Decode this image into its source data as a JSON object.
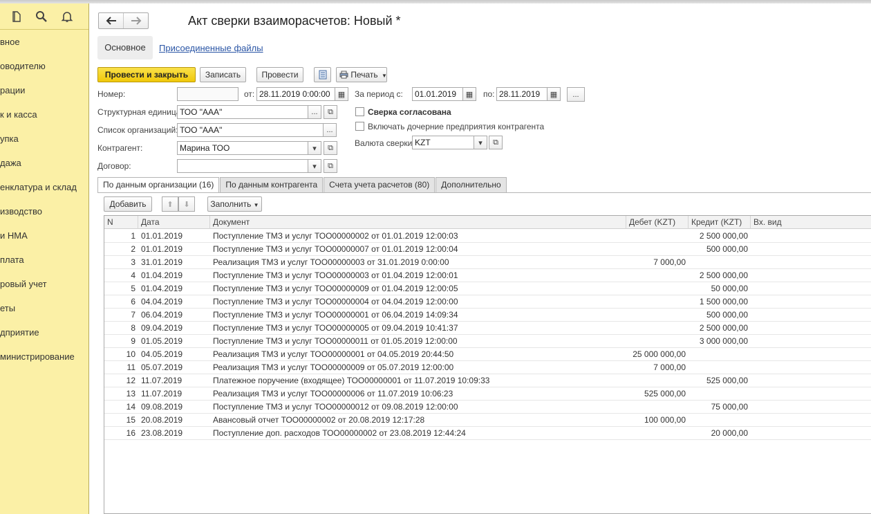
{
  "sidebar": {
    "items": [
      "вное",
      "оводителю",
      "рации",
      "к и касса",
      "упка",
      "дажа",
      "енклатура и склад",
      "изводство",
      "и НМА",
      "плата",
      "ровый учет",
      "еты",
      "дприятие",
      "министрирование"
    ]
  },
  "header": {
    "title": "Акт сверки взаиморасчетов: Новый *",
    "tab_main": "Основное",
    "tab_files": "Присоединенные файлы"
  },
  "toolbar": {
    "post_close": "Провести и закрыть",
    "save": "Записать",
    "post": "Провести",
    "print": "Печать"
  },
  "form": {
    "number_label": "Номер:",
    "number_value": "",
    "from_label": "от:",
    "date_value": "28.11.2019  0:00:00",
    "period_label": "За период с:",
    "period_from": "01.01.2019",
    "period_to_label": "по:",
    "period_to": "28.11.2019",
    "struct_label": "Структурная единица:",
    "struct_value": "ТОО \"ААА\"",
    "orgs_label": "Список организаций:",
    "orgs_value": "ТОО \"ААА\"",
    "contractor_label": "Контрагент:",
    "contractor_value": "Марина ТОО",
    "contract_label": "Договор:",
    "contract_value": "",
    "agreed_label": "Сверка согласована",
    "include_label": "Включать дочерние предприятия контрагента",
    "currency_label": "Валюта сверки:",
    "currency_value": "KZT"
  },
  "tabs": [
    "По данным организации (16)",
    "По данным контрагента",
    "Счета учета расчетов (80)",
    "Дополнительно"
  ],
  "table_toolbar": {
    "add": "Добавить",
    "fill": "Заполнить"
  },
  "table": {
    "headers": [
      "N",
      "Дата",
      "Документ",
      "Дебет (KZT)",
      "Кредит (KZT)",
      "Вх. вид"
    ],
    "rows": [
      [
        "1",
        "01.01.2019",
        "Поступление ТМЗ и услуг ТОО00000002 от 01.01.2019 12:00:03",
        "",
        "2 500 000,00"
      ],
      [
        "2",
        "01.01.2019",
        "Поступление ТМЗ и услуг ТОО00000007 от 01.01.2019 12:00:04",
        "",
        "500 000,00"
      ],
      [
        "3",
        "31.01.2019",
        "Реализация ТМЗ и услуг ТОО00000003 от 31.01.2019 0:00:00",
        "7 000,00",
        ""
      ],
      [
        "4",
        "01.04.2019",
        "Поступление ТМЗ и услуг ТОО00000003 от 01.04.2019 12:00:01",
        "",
        "2 500 000,00"
      ],
      [
        "5",
        "01.04.2019",
        "Поступление ТМЗ и услуг ТОО00000009 от 01.04.2019 12:00:05",
        "",
        "50 000,00"
      ],
      [
        "6",
        "04.04.2019",
        "Поступление ТМЗ и услуг ТОО00000004 от 04.04.2019 12:00:00",
        "",
        "1 500 000,00"
      ],
      [
        "7",
        "06.04.2019",
        "Поступление ТМЗ и услуг ТОО00000001 от 06.04.2019 14:09:34",
        "",
        "500 000,00"
      ],
      [
        "8",
        "09.04.2019",
        "Поступление ТМЗ и услуг ТОО00000005 от 09.04.2019 10:41:37",
        "",
        "2 500 000,00"
      ],
      [
        "9",
        "01.05.2019",
        "Поступление ТМЗ и услуг ТОО00000011 от 01.05.2019 12:00:00",
        "",
        "3 000 000,00"
      ],
      [
        "10",
        "04.05.2019",
        "Реализация ТМЗ и услуг ТОО00000001 от 04.05.2019 20:44:50",
        "25 000 000,00",
        ""
      ],
      [
        "11",
        "05.07.2019",
        "Реализация ТМЗ и услуг ТОО00000009 от 05.07.2019 12:00:00",
        "7 000,00",
        ""
      ],
      [
        "12",
        "11.07.2019",
        "Платежное поручение (входящее) ТОО00000001 от 11.07.2019 10:09:33",
        "",
        "525 000,00"
      ],
      [
        "13",
        "11.07.2019",
        "Реализация ТМЗ и услуг ТОО00000006 от 11.07.2019 10:06:23",
        "525 000,00",
        ""
      ],
      [
        "14",
        "09.08.2019",
        "Поступление ТМЗ и услуг ТОО00000012 от 09.08.2019 12:00:00",
        "",
        "75 000,00"
      ],
      [
        "15",
        "20.08.2019",
        "Авансовый отчет ТОО00000002 от 20.08.2019 12:17:28",
        "100 000,00",
        ""
      ],
      [
        "16",
        "23.08.2019",
        "Поступление доп. расходов ТОО00000002 от 23.08.2019 12:44:24",
        "",
        "20 000,00"
      ]
    ]
  },
  "colors": {
    "sidebar_bg": "#fbf0a6",
    "primary_button": "#f0c80a",
    "link": "#2a55a5"
  }
}
